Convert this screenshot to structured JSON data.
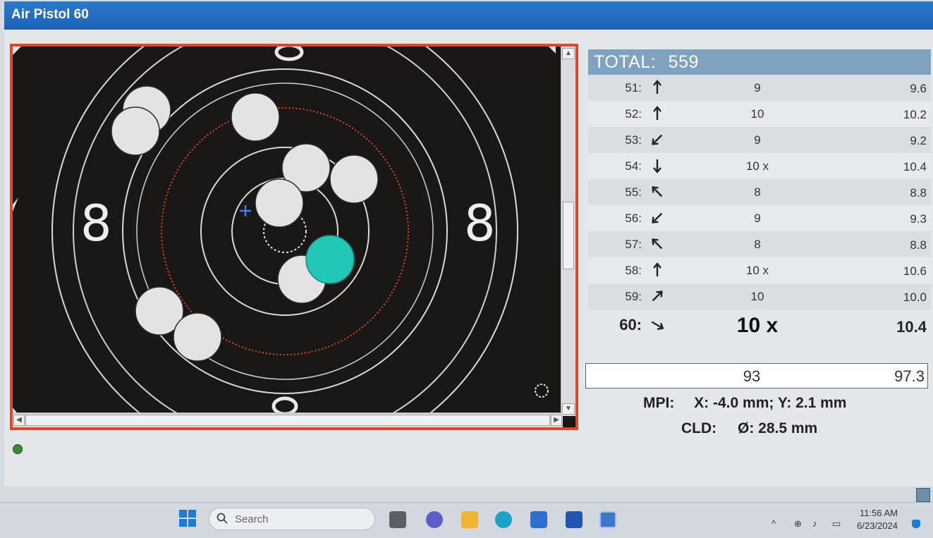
{
  "window": {
    "title": "Air Pistol 60"
  },
  "target": {
    "ring_labels": [
      "8",
      "8"
    ]
  },
  "scoreboard": {
    "total_label": "TOTAL:",
    "total_value": "559",
    "shots": [
      {
        "num": "51:",
        "direction": "north-arrow-icon",
        "score": "9",
        "decimal": "9.6"
      },
      {
        "num": "52:",
        "direction": "north-arrow-icon",
        "score": "10",
        "decimal": "10.2"
      },
      {
        "num": "53:",
        "direction": "southwest-arrow-icon",
        "score": "9",
        "decimal": "9.2"
      },
      {
        "num": "54:",
        "direction": "south-arrow-icon",
        "score": "10 x",
        "decimal": "10.4"
      },
      {
        "num": "55:",
        "direction": "northwest-arrow-icon",
        "score": "8",
        "decimal": "8.8"
      },
      {
        "num": "56:",
        "direction": "southwest-arrow-icon",
        "score": "9",
        "decimal": "9.3"
      },
      {
        "num": "57:",
        "direction": "northwest-arrow-icon",
        "score": "8",
        "decimal": "8.8"
      },
      {
        "num": "58:",
        "direction": "north-arrow-icon",
        "score": "10 x",
        "decimal": "10.6"
      },
      {
        "num": "59:",
        "direction": "northeast-arrow-icon",
        "score": "10",
        "decimal": "10.0"
      },
      {
        "num": "60:",
        "direction": "southeast-arrow-icon",
        "score": "10 x",
        "decimal": "10.4"
      }
    ],
    "series_sum": "93",
    "series_decimal": "97.3",
    "mpi_label": "MPI:",
    "mpi_value": "X: -4.0 mm; Y: 2.1 mm",
    "cld_label": "CLD:",
    "cld_value": "Ø: 28.5 mm"
  },
  "taskbar": {
    "search_placeholder": "Search",
    "time": "11:56 AM",
    "date": "6/23/2024"
  },
  "colors": {
    "title_bar": "#1f66b9",
    "target_border": "#e0462b",
    "last_shot": "#22c7b8",
    "total_header": "#7fa2be"
  }
}
